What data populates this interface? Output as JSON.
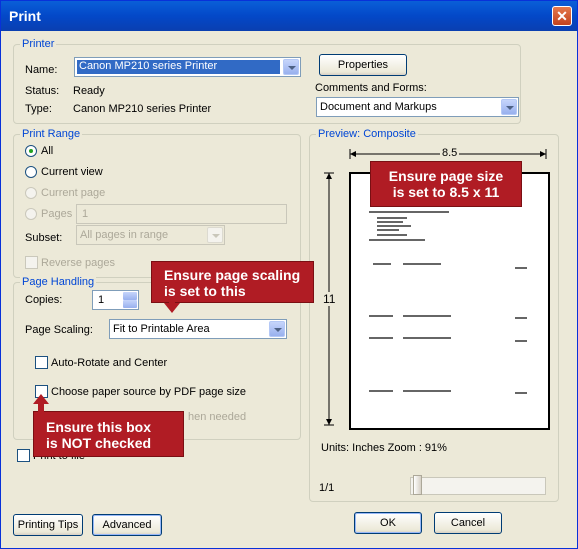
{
  "window": {
    "title": "Print",
    "close_glyph": "✕"
  },
  "printer": {
    "legend": "Printer",
    "name_label": "Name:",
    "name_value": "Canon MP210 series Printer",
    "status_label": "Status:",
    "status_value": "Ready",
    "type_label": "Type:",
    "type_value": "Canon MP210 series Printer",
    "properties_button": "Properties",
    "comments_label": "Comments and Forms:",
    "comments_value": "Document and Markups"
  },
  "print_range": {
    "legend": "Print Range",
    "all": "All",
    "current_view": "Current view",
    "current_page": "Current page",
    "pages": "Pages",
    "pages_value": "1",
    "subset_label": "Subset:",
    "subset_value": "All pages in range",
    "reverse_pages": "Reverse pages"
  },
  "page_handling": {
    "legend": "Page Handling",
    "copies_label": "Copies:",
    "copies_value": "1",
    "scaling_label": "Page Scaling:",
    "scaling_value": "Fit to Printable Area",
    "auto_rotate": "Auto-Rotate and Center",
    "choose_source": "Choose paper source by PDF page size",
    "hidden_option_fragment": "hen needed"
  },
  "print_to_file": "Print to file",
  "preview": {
    "legend": "Preview: Composite",
    "width_label": "8.5",
    "height_label": "11",
    "units_zoom": "Units: Inches Zoom :  91%",
    "page_indicator": "1/1"
  },
  "buttons": {
    "printing_tips": "Printing Tips",
    "advanced": "Advanced",
    "ok": "OK",
    "cancel": "Cancel"
  },
  "callouts": {
    "page_size": "Ensure page size\nis set to 8.5 x 11",
    "page_scaling": "Ensure page scaling\nis set to this",
    "box_unchecked": "Ensure this box\nis NOT checked"
  },
  "colors": {
    "callout": "#b01c24",
    "legend": "#0046d5",
    "selection": "#316ac5"
  }
}
